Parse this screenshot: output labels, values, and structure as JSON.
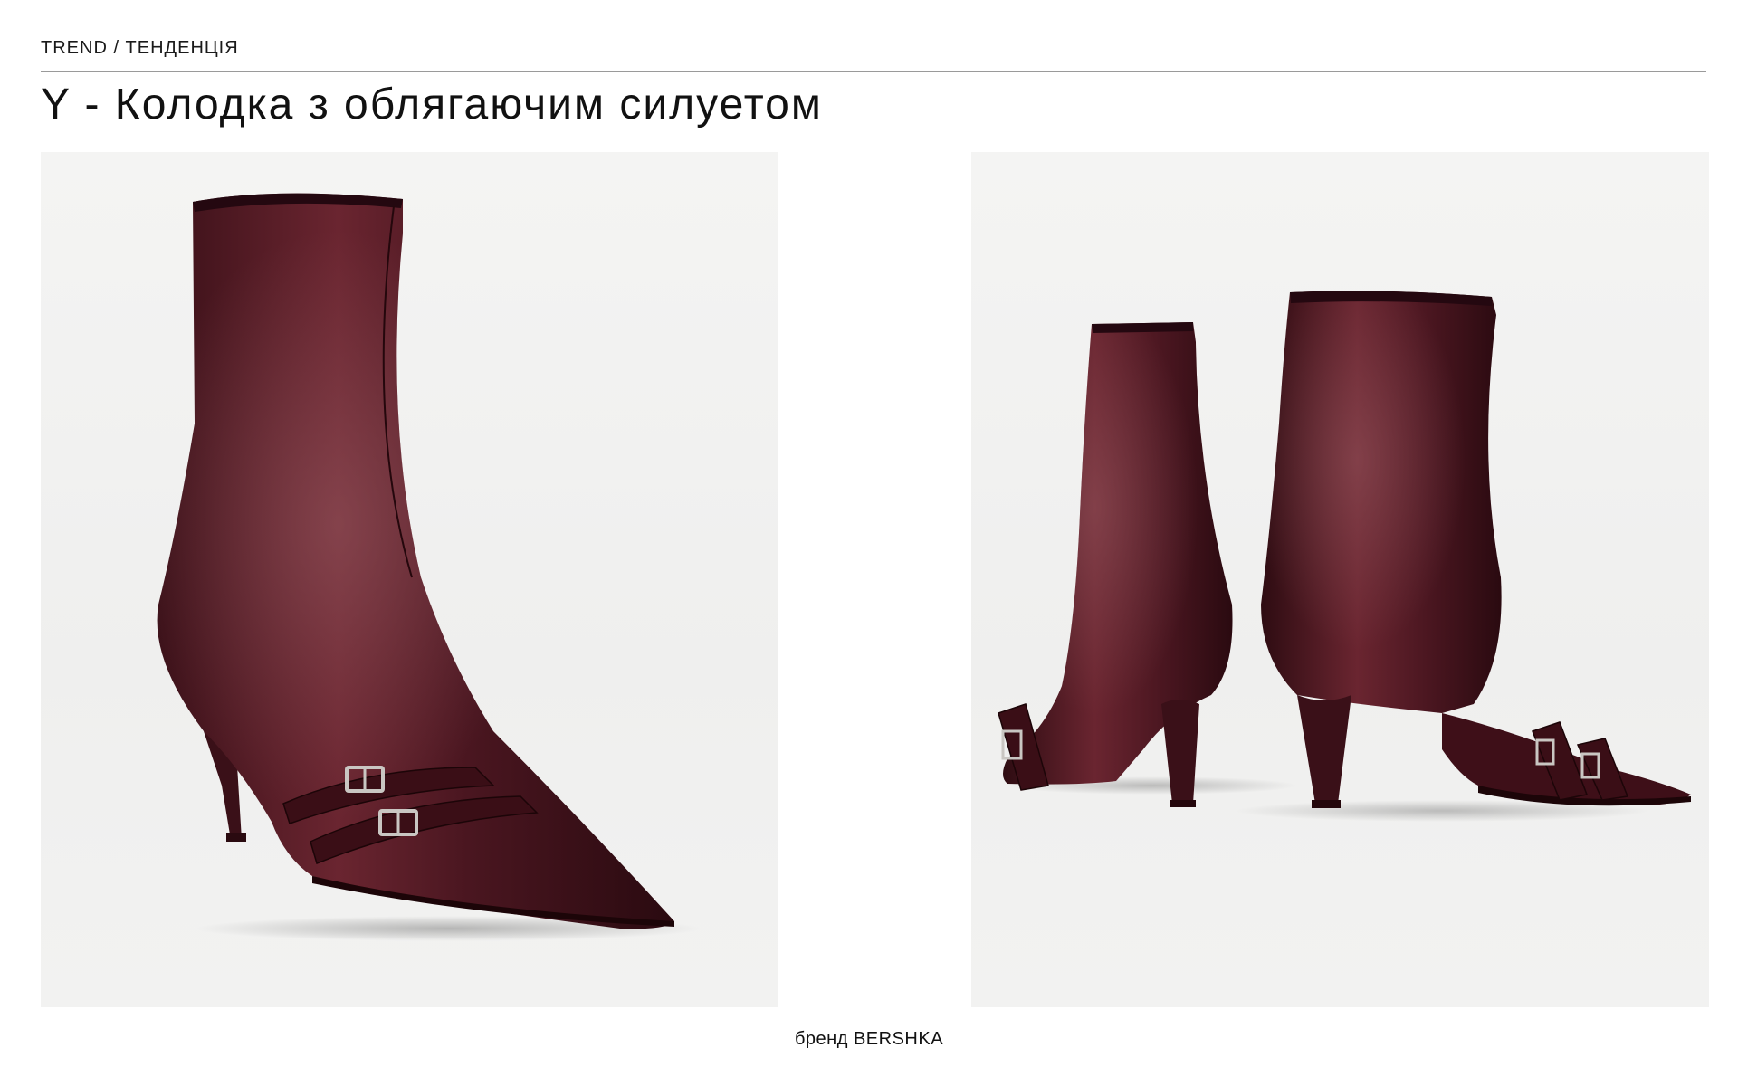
{
  "header": {
    "kicker": "TREND / ТЕНДЕНЦІЯ",
    "title": "Y - Колодка з облягаючим силуетом"
  },
  "images": [
    {
      "subject": "boot-front-three-quarter-view"
    },
    {
      "subject": "pair-of-boots-rear-view"
    }
  ],
  "footer": {
    "caption": "бренд BERSHKA"
  },
  "colors": {
    "leather_dark": "#2e0c12",
    "leather_mid": "#5a1a24",
    "leather_highlight": "#8a4a52",
    "background": "#ffffff",
    "photo_bg": "#f1f1f0",
    "rule": "#9a9a9a"
  }
}
